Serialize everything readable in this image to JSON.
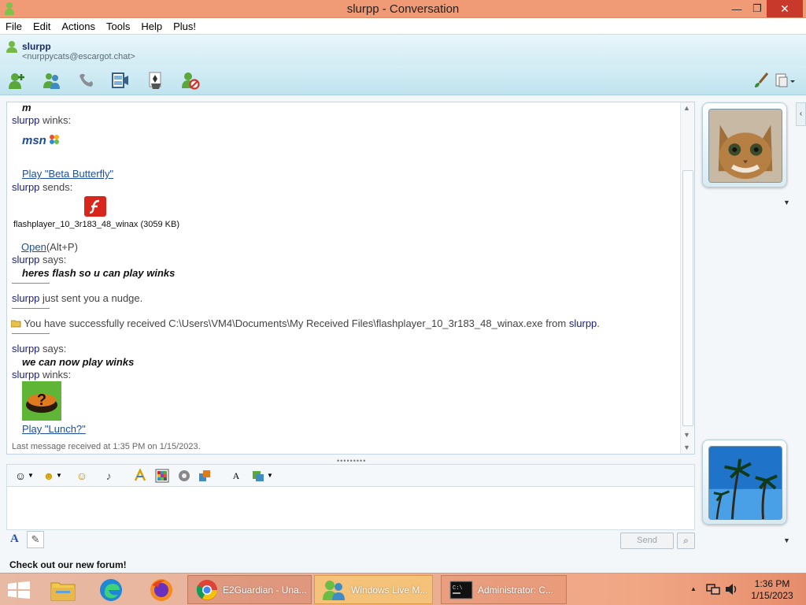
{
  "window": {
    "title": "slurpp - Conversation",
    "min_glyph": "—",
    "max_glyph": "❐",
    "close_glyph": "✕"
  },
  "menu": [
    "File",
    "Edit",
    "Actions",
    "Tools",
    "Help",
    "Plus!"
  ],
  "contact": {
    "name": "slurpp",
    "email": "<nurppycats@escargot.chat>"
  },
  "toolbar": {
    "icons": [
      "invite-contact-icon",
      "share-files-icon",
      "call-icon",
      "video-icon",
      "games-icon",
      "block-icon",
      "paint-brush-icon",
      "display-options-icon"
    ]
  },
  "conversation": {
    "top_partial": "m",
    "wink1_sender": "slurpp",
    "wink1_action": "winks:",
    "wink1_logo_text": "msn",
    "wink1_play": "Play \"Beta Butterfly\"",
    "send_sender": "slurpp",
    "send_action": "sends:",
    "file_name": "flashplayer_10_3r183_48_winax (3059 KB)",
    "open_link": "Open",
    "open_shortcut": "(Alt+P)",
    "says1_sender": "slurpp",
    "says1_action": "says:",
    "says1_msg": "heres flash so u can play winks",
    "nudge_sender": "slurpp",
    "nudge_text": "just sent you a nudge.",
    "received_text": "You have successfully received C:\\Users\\VM4\\Documents\\My Received Files\\flashplayer_10_3r183_48_winax.exe from",
    "received_from": "slurpp",
    "received_end": ".",
    "says2_sender": "slurpp",
    "says2_action": "says:",
    "says2_msg": "we can now play winks",
    "wink2_sender": "slurpp",
    "wink2_action": "winks:",
    "wink2_play": "Play \"Lunch?\"",
    "last_message": "Last message received at 1:35 PM on 1/15/2023."
  },
  "compose": {
    "send_label": "Send",
    "format_icons": [
      "emoticon-icon",
      "wink-icon",
      "nudge-icon",
      "voice-clip-icon",
      "font-icon",
      "background-icon",
      "ink-icon",
      "handwriting-icon",
      "font-style-icon",
      "format-icon"
    ]
  },
  "footer": {
    "banner": "Check out our new forum!"
  },
  "taskbar": {
    "tasks": [
      {
        "label": "E2Guardian - Una..."
      },
      {
        "label": "Windows Live M..."
      },
      {
        "label": "Administrator:  C..."
      }
    ],
    "time": "1:36 PM",
    "date": "1/15/2023",
    "start_icon": "windows-start-icon"
  },
  "colors": {
    "titlebar": "#f19a76",
    "sender": "#1a1f7a",
    "link": "#1b4fa0",
    "taskbar": "#eab29a"
  }
}
